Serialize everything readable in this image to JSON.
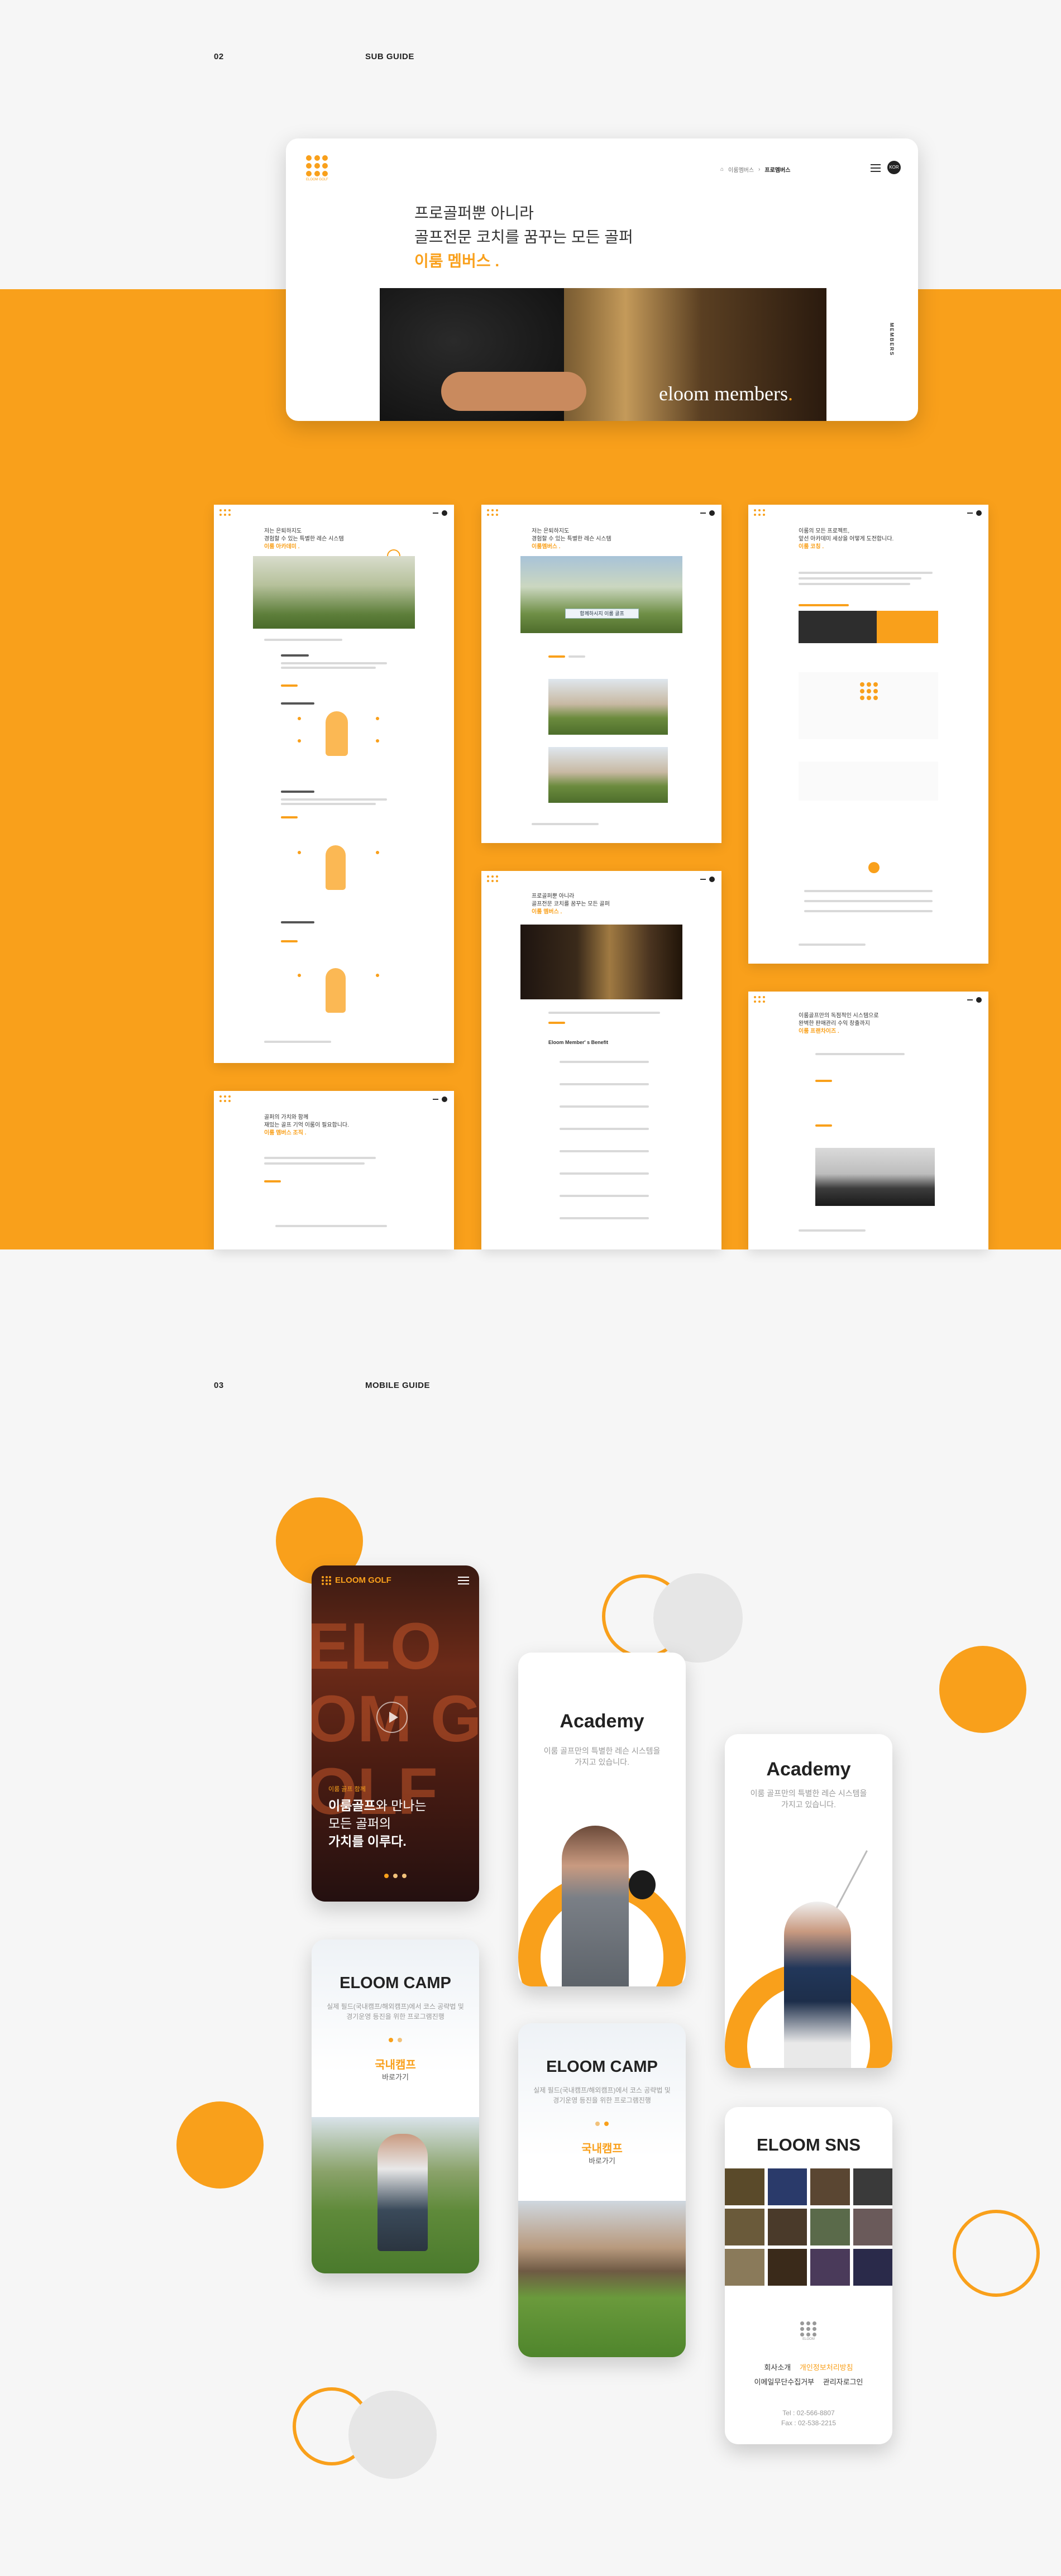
{
  "sections": {
    "sub": {
      "num": "02",
      "title": "SUB GUIDE"
    },
    "mobile": {
      "num": "03",
      "title": "MOBILE GUIDE"
    }
  },
  "hero": {
    "brand": "ELOOM GOLF",
    "breadcrumb": [
      "이룸멤버스",
      "프로멤버스"
    ],
    "headline_1": "프로골퍼뿐 아니라",
    "headline_2": "골프전문 코치를 꿈꾸는 모든 골퍼",
    "headline_accent": "이룸 멤버스 .",
    "side_label": "MEMBERS",
    "photo_caption": "eloom members",
    "photo_caption_dot": "."
  },
  "mockups": {
    "m1": {
      "title": "저는 은퇴하지도",
      "sub": "경험할 수 있는 특별한 레슨 시스템",
      "accent": "이룸 아카데미 ."
    },
    "m2": {
      "title": "저는 은퇴하지도",
      "sub": "경험할 수 있는 특별한 레슨 시스템",
      "accent": "이룸멤버스 .",
      "banner": "함께하시지 이룸 골프"
    },
    "m3": {
      "title": "이룸의 모든 프로젝트,",
      "sub": "앞선 아카데미 세상을 어떻게 도전합니다.",
      "accent": "이룸 코칭 ."
    },
    "m4": {
      "title": "골퍼의 가치와 함께",
      "sub": "재밌는 골프 기억 이룸이 필요합니다.",
      "accent": "이룸 멤버스 조직 ."
    },
    "m5": {
      "title": "프로골퍼뿐 아니라",
      "sub": "골프전문 코치를 꿈꾸는 모든 골퍼",
      "accent": "이룸 멤버스 .",
      "benefit": "Eloom Member' s Benefit"
    },
    "m6": {
      "title": "이룸골프만의 독점적인 시스템으로",
      "sub": "완벽한 판매관리 수익 창출까지",
      "accent": "이룸 프랜차이즈 ."
    }
  },
  "phones": {
    "p1": {
      "brand": "ELOOM GOLF",
      "kicker": "이룸 골프 함께",
      "line1a": "이룸골프",
      "line1b": "와 만나는",
      "line2": "모든 골퍼의",
      "line3": "가치를 이루다.",
      "sign": "ELOOM GOLF"
    },
    "p2": {
      "title": "Academy",
      "sub1": "이룸 골프만의 특별한 레슨 시스템을",
      "sub2": "가지고 있습니다."
    },
    "p3": {
      "title": "Academy",
      "sub1": "이룸 골프만의 특별한 레슨 시스템을",
      "sub2": "가지고 있습니다."
    },
    "p4": {
      "title": "ELOOM CAMP",
      "sub1": "실제 필드(국내캠프/해외캠프)에서 코스 공략법 및",
      "sub2": "경기운영 등진을 위한 프로그램진행",
      "accent": "국내캠프",
      "link": "바로가기"
    },
    "p5": {
      "title": "ELOOM CAMP",
      "sub1": "실제 필드(국내캠프/해외캠프)에서 코스 공략법 및",
      "sub2": "경기운영 등진을 위한 프로그램진행",
      "accent": "국내캠프",
      "link": "바로가기"
    },
    "p6": {
      "title": "ELOOM SNS",
      "links_row1": [
        "회사소개",
        "개인정보처리방침"
      ],
      "links_row2": [
        "이메일무단수집거부",
        "관리자로그인"
      ],
      "tel": "Tel : 02-566-8807",
      "fax": "Fax : 02-538-2215",
      "logo_text": "ELOOM"
    }
  },
  "colors": {
    "accent": "#f9a01b",
    "bg": "#f6f6f6",
    "dark": "#222222"
  }
}
